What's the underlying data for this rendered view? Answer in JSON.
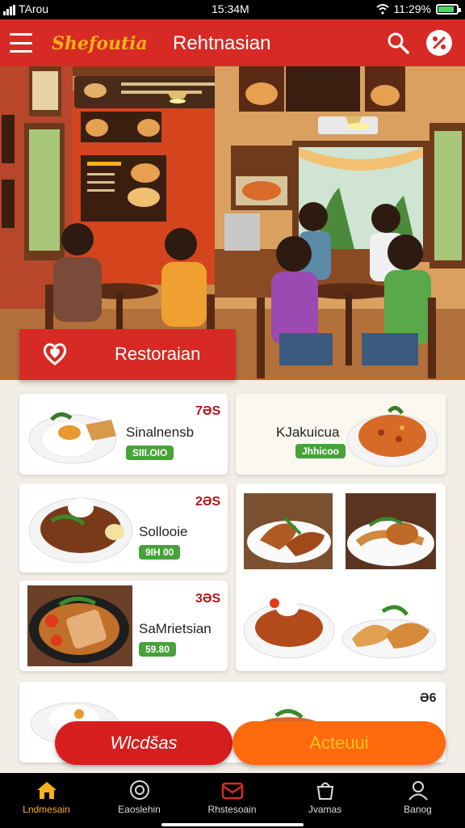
{
  "status_bar": {
    "carrier": "TArou",
    "time": "15:34M",
    "battery_text": "11:29%"
  },
  "app_bar": {
    "brand": "Shefoutia",
    "title": "Rehtnasian",
    "icons": [
      "menu-icon",
      "search-icon",
      "discount-icon"
    ]
  },
  "hero": {
    "banner_label": "Restoraian",
    "banner_icon": "heart-icon"
  },
  "menu_cards": [
    {
      "name": "Sinalnensb",
      "price": "7ƏS",
      "tag": "SIII.OIO"
    },
    {
      "name": "KJakuicua",
      "price": "",
      "tag": "Jhhicoo"
    },
    {
      "name": "Sollooie",
      "price": "2ƏS",
      "tag": "9IH 00"
    },
    {
      "name": "SaMrietsian",
      "price": "3ƏS",
      "tag": "59.80"
    },
    {
      "name": "",
      "price": "Ə6",
      "tag": ""
    }
  ],
  "actions": {
    "primary_label": "Wlcdšas",
    "secondary_label": "Acteuui"
  },
  "bottom_nav": [
    {
      "label": "Lndmesain",
      "icon": "home-icon",
      "active": true
    },
    {
      "label": "Eaoslehin",
      "icon": "info-icon",
      "active": false
    },
    {
      "label": "Rhstesoain",
      "icon": "mail-icon",
      "active": false
    },
    {
      "label": "Jvamas",
      "icon": "bag-icon",
      "active": false
    },
    {
      "label": "Banog",
      "icon": "profile-icon",
      "active": false
    }
  ],
  "colors": {
    "brand_red": "#d72a25",
    "accent_orange": "#ff6a0f",
    "price_red": "#b0151b",
    "tag_green": "#47a23a",
    "brand_gold": "#f6b21c"
  }
}
